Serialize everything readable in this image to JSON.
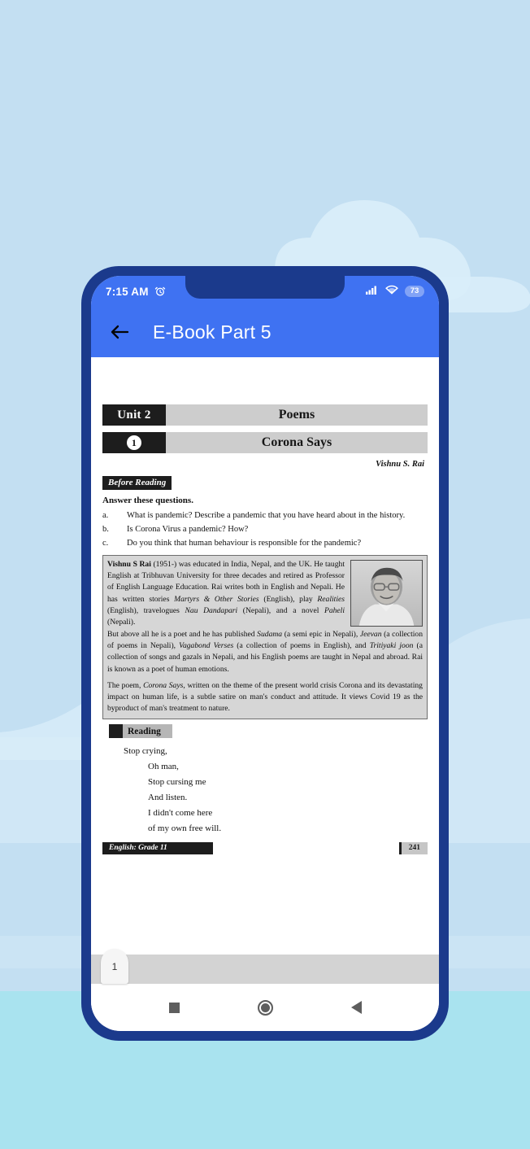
{
  "theme": {
    "sky_color": "#c3dff2",
    "sea_color": "#a9e3ef",
    "cloud_color": "#d7ecf8",
    "phone_frame_color": "#1b3a8c",
    "appbar_color": "#3f72f2",
    "accent_text_color": "#ffffff"
  },
  "status_bar": {
    "time": "7:15 AM",
    "alarm_icon": "alarm-icon",
    "signal_icon": "cellular-signal-icon",
    "wifi_icon": "wifi-icon",
    "battery_level": "73"
  },
  "app_bar": {
    "back_icon": "back-arrow-icon",
    "title": "E-Book Part 5"
  },
  "document": {
    "unit_banner": {
      "tag": "Unit 2",
      "title": "Poems"
    },
    "chapter_banner": {
      "number": "1",
      "title": "Corona Says"
    },
    "byline": "Vishnu S. Rai",
    "before_reading": {
      "label": "Before Reading",
      "instruction": "Answer these questions.",
      "questions": [
        {
          "letter": "a.",
          "text": "What is pandemic? Describe a pandemic that you have heard about in the history."
        },
        {
          "letter": "b.",
          "text": "Is Corona Virus a pandemic? How?"
        },
        {
          "letter": "c.",
          "text": "Do you think that human behaviour is responsible for the pandemic?"
        }
      ]
    },
    "bio_box": {
      "photo_alt": "author-portrait",
      "paragraph_1_html": "<b>Vishnu S Rai</b> (1951-) was educated in India, Nepal, and the UK. He taught English at Tribhuvan University for three decades and retired as Professor of English Language Education. Rai writes both in English and Nepali. He has written stories <i>Martyrs &amp; Other Stories</i> (English), play <i>Realities</i> (English), travelogues <i>Nau Dandapari</i> (Nepali), and a novel <i>Paheli</i> (Nepali).",
      "paragraph_2_html": "But above all he is a poet and he has published <i>Sudama</i> (a semi epic in Nepali), <i>Jeevan</i> (a collection of poems in Nepali), <i>Vagabond Verses</i> (a collection of poems in English), and <i>Tritiyaki joon</i> (a collection of songs and gazals in Nepali, and his English poems are taught in Nepal and abroad. Rai is known as a poet of human emotions.",
      "paragraph_3_html": "The poem, <i>Corona Says</i>, written on the theme of the present world crisis Corona and its devastating impact on human life, is a subtle satire on man's conduct and attitude. It views Covid 19 as the byproduct of man's treatment to nature."
    },
    "reading": {
      "label": "Reading",
      "poem_lines": [
        {
          "text": "Stop crying,",
          "indent": 1
        },
        {
          "text": "Oh man,",
          "indent": 2
        },
        {
          "text": "Stop cursing me",
          "indent": 2
        },
        {
          "text": "And listen.",
          "indent": 2
        },
        {
          "text": "I didn't come here",
          "indent": 2
        },
        {
          "text": "of my own free will.",
          "indent": 2
        }
      ]
    },
    "page_footer": {
      "book_label": "English: Grade 11",
      "page_number": "241"
    }
  },
  "scrubber": {
    "current_page_chip": "1"
  },
  "nav_bar": {
    "recents_icon": "recents-square-icon",
    "home_icon": "home-circle-icon",
    "back_icon": "back-triangle-icon"
  }
}
